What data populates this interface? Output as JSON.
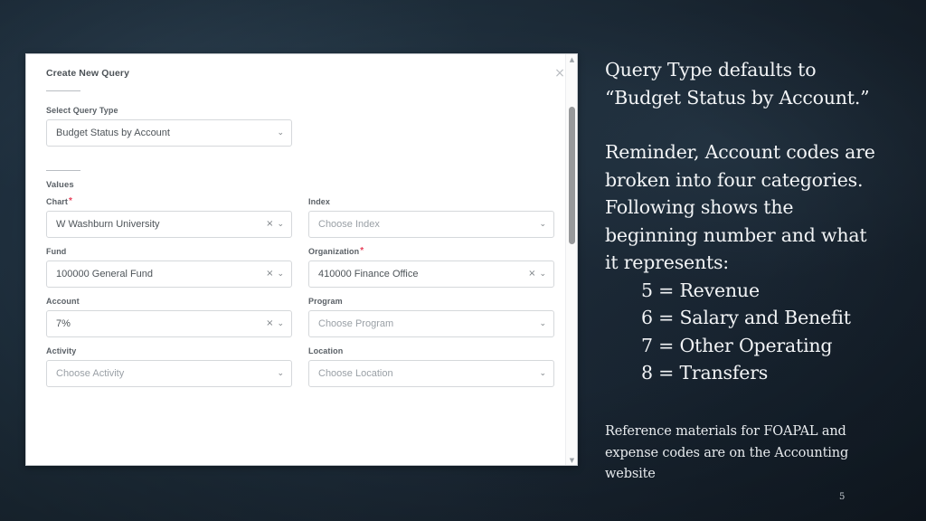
{
  "slide": {
    "number": "5",
    "background_color": "#1d2b38",
    "text_color": "#f2f4f6"
  },
  "dialog": {
    "title": "Create New Query",
    "close_icon": "×",
    "query_type": {
      "label": "Select Query Type",
      "value": "Budget Status by Account"
    },
    "values_label": "Values",
    "fields": [
      {
        "label": "Chart",
        "required": true,
        "value": "W Washburn University",
        "placeholder": "",
        "has_clear": true,
        "filled": true
      },
      {
        "label": "Index",
        "required": false,
        "value": "",
        "placeholder": "Choose Index",
        "has_clear": false,
        "filled": false
      },
      {
        "label": "Fund",
        "required": false,
        "value": "100000 General Fund",
        "placeholder": "",
        "has_clear": true,
        "filled": true
      },
      {
        "label": "Organization",
        "required": true,
        "value": "410000 Finance Office",
        "placeholder": "",
        "has_clear": true,
        "filled": true
      },
      {
        "label": "Account",
        "required": false,
        "value": "7%",
        "placeholder": "",
        "has_clear": true,
        "filled": true
      },
      {
        "label": "Program",
        "required": false,
        "value": "",
        "placeholder": "Choose Program",
        "has_clear": false,
        "filled": false
      },
      {
        "label": "Activity",
        "required": false,
        "value": "",
        "placeholder": "Choose Activity",
        "has_clear": false,
        "filled": false
      },
      {
        "label": "Location",
        "required": false,
        "value": "",
        "placeholder": "Choose Location",
        "has_clear": false,
        "filled": false
      }
    ],
    "icons": {
      "clear": "×",
      "chevron_down": "⌄",
      "scroll_up": "▲",
      "scroll_down": "▼"
    }
  },
  "notes": {
    "para1_line1": "Query Type defaults to",
    "para1_line2": "“Budget Status by Account.”",
    "para2_line1": "Reminder, Account codes are",
    "para2_line2": "broken into four categories.",
    "para2_line3": "Following shows the",
    "para2_line4": "beginning number and what",
    "para2_line5": "it represents:",
    "categories": [
      "5 = Revenue",
      "6 = Salary and Benefit",
      "7 = Other Operating",
      "8 = Transfers"
    ],
    "footnote_line1": "Reference materials for FOAPAL and",
    "footnote_line2": "expense codes are on the Accounting",
    "footnote_line3": "website"
  }
}
